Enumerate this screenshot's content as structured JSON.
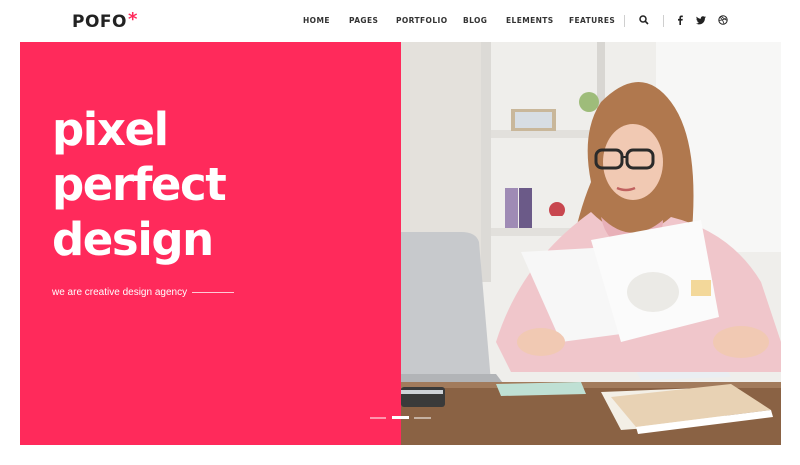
{
  "header": {
    "logo": "POFO",
    "logo_mark": "*",
    "nav": [
      "HOME",
      "PAGES",
      "PORTFOLIO",
      "BLOG",
      "ELEMENTS",
      "FEATURES"
    ],
    "icons": [
      "search-icon",
      "facebook-icon",
      "twitter-icon",
      "dribbble-icon"
    ]
  },
  "hero": {
    "headline": [
      "pixel",
      "perfect",
      "design"
    ],
    "tagline": "we are creative design agency",
    "slides": 3,
    "active_slide": 2,
    "image": "woman-reviewing-papers-at-desk",
    "accent_color": "#ff2a5b"
  }
}
